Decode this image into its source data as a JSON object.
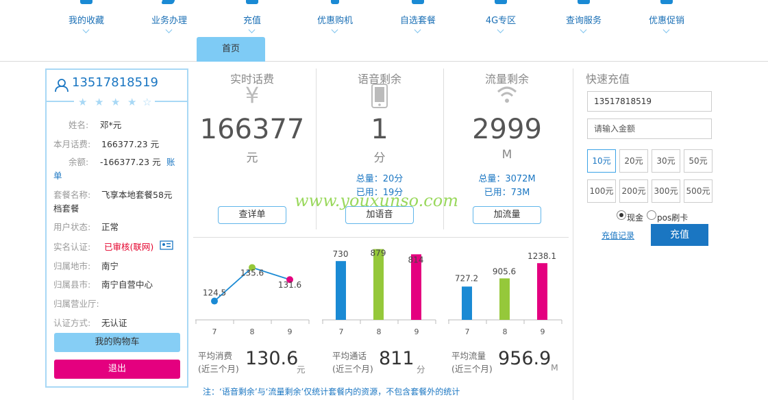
{
  "nav": {
    "items": [
      {
        "label": "我的收藏",
        "icon": "star-icon"
      },
      {
        "label": "业务办理",
        "icon": "handshake-icon"
      },
      {
        "label": "充值",
        "icon": "wallet-icon"
      },
      {
        "label": "优惠购机",
        "icon": "phone-icon"
      },
      {
        "label": "自选套餐",
        "icon": "box-icon"
      },
      {
        "label": "4G专区",
        "icon": "signal-icon"
      },
      {
        "label": "查询服务",
        "icon": "search-icon"
      },
      {
        "label": "优惠促销",
        "icon": "gift-icon"
      }
    ],
    "home_tab": "首页"
  },
  "profile": {
    "phone": "13517818519",
    "stars_filled": 4,
    "stars_total": 5,
    "fields": {
      "name_label": "姓名:",
      "name": "邓*元",
      "bill_label": "本月话费:",
      "bill": "166377.23 元",
      "balance_label": "余额:",
      "balance": "-166377.23 元",
      "balance_link_a": "账",
      "balance_link_b": "单",
      "plan_label": "套餐名称:",
      "plan_a": "飞享本地套餐58元",
      "plan_b": "档套餐",
      "status_label": "用户状态:",
      "status": "正常",
      "realname_label": "实名认证:",
      "realname": "已审核(联网)",
      "city_label": "归属地市:",
      "city": "南宁",
      "county_label": "归属县市:",
      "county": "南宁自营中心",
      "hall_label": "归属营业厅:",
      "hall": "",
      "auth_label": "认证方式:",
      "auth": "无认证"
    },
    "cart_button": "我的购物车",
    "logout_button": "退出"
  },
  "stats": [
    {
      "title": "实时话费",
      "icon": "yen-icon",
      "value": "166377",
      "unit": "元",
      "line1": "",
      "line2": "",
      "button": "查详单"
    },
    {
      "title": "语音剩余",
      "icon": "mobile-icon",
      "value": "1",
      "unit": "分",
      "line1": "总量：20分",
      "line2": "已用：19分",
      "button": "加语音"
    },
    {
      "title": "流量剩余",
      "icon": "wifi-icon",
      "value": "2999",
      "unit": "M",
      "line1": "总量：3072M",
      "line2": "已用：73M",
      "button": "加流量"
    }
  ],
  "quick_recharge": {
    "title": "快速充值",
    "phone_value": "13517818519",
    "amount_placeholder": "请输入金额",
    "amounts": [
      "10元",
      "20元",
      "30元",
      "50元",
      "100元",
      "200元",
      "300元",
      "500元"
    ],
    "selected_amount": "10元",
    "payment_options": [
      "现金",
      "pos刷卡"
    ],
    "selected_payment": "现金",
    "history_link": "充值记录",
    "submit_button": "充值"
  },
  "chart_data": [
    {
      "type": "line",
      "categories": [
        "7",
        "8",
        "9"
      ],
      "values": [
        124.5,
        135.6,
        131.6
      ],
      "colors": [
        "#1a8ad4",
        "#95c83a",
        "#e4007f"
      ]
    },
    {
      "type": "bar",
      "categories": [
        "7",
        "8",
        "9"
      ],
      "values": [
        730,
        879,
        814
      ],
      "value_labels": [
        "730",
        "879",
        "814"
      ],
      "colors": [
        "#1a8ad4",
        "#95c83a",
        "#e4007f"
      ]
    },
    {
      "type": "bar",
      "categories": [
        "7",
        "8",
        "9"
      ],
      "values": [
        727.2,
        905.6,
        1238.1
      ],
      "colors": [
        "#1a8ad4",
        "#95c83a",
        "#e4007f"
      ]
    }
  ],
  "averages": [
    {
      "label_a": "平均消费",
      "label_b": "(近三个月)",
      "value": "130.6",
      "unit": "元"
    },
    {
      "label_a": "平均通话",
      "label_b": "(近三个月)",
      "value": "811",
      "unit": "分"
    },
    {
      "label_a": "平均流量",
      "label_b": "(近三个月)",
      "value": "956.9",
      "unit": "M"
    }
  ],
  "note": "注：‘语音剩余’与‘流量剩余’仅统计套餐内的资源，不包含套餐外的统计",
  "watermark": "www.youxunso.com"
}
